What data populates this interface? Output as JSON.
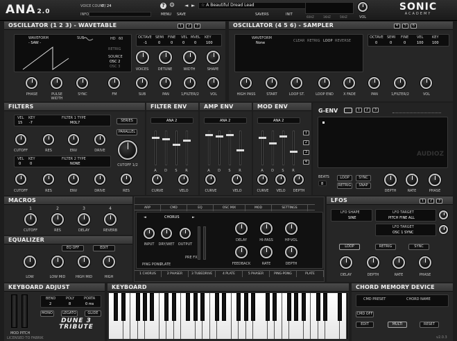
{
  "top": {
    "logo": "ANA",
    "logo_ver": "2.0",
    "voice_count_label": "VOICE COUNT",
    "voice_count": "0 / 24",
    "info_label": "INFO",
    "menu": "MENU",
    "save": "SAVE",
    "preset_name": "A Beautiful Dread Lead",
    "savers": "SAVERS",
    "init": "INIT",
    "scope_labels": [
      "60HZ",
      "1KHZ",
      "5KHZ"
    ],
    "vol": "VOL",
    "brand": "SONIC",
    "brand_sub": "ACADEMY"
  },
  "osc1": {
    "title": "OSCILLATOR (1 2 3) - WAVETABLE",
    "tabs": [
      "1",
      "2",
      "3"
    ],
    "waveform_label": "WAVEFORM",
    "waveform": "- SAW -",
    "sub_label": "SUB",
    "hd": "HD",
    "hd_val": "60",
    "retrig": "RETRIG",
    "source": "SOURCE",
    "osc2": "OSC 2",
    "osc3": "OSC 3",
    "param_heads": [
      "OCTAVE",
      "SEMI",
      "FINE",
      "VEL",
      "MVEL",
      "KEY"
    ],
    "param_vals": [
      "-1",
      "0",
      "0",
      "0",
      "0",
      "100"
    ],
    "knobs_row1": [
      "VOICES",
      "DETUNE",
      "WIDTH",
      "SHAPE"
    ],
    "knobs_row2": [
      "PHASE",
      "PULSE WIDTH",
      "SYNC",
      "FM",
      "SUB",
      "PAN",
      "1/FILTER/2",
      "VOL"
    ]
  },
  "osc2": {
    "title": "OSCILLATOR (4 5 6) - SAMPLER",
    "tabs": [
      "4",
      "5",
      "6"
    ],
    "waveform_label": "WAVEFORM",
    "waveform": "None",
    "opts": [
      "CLEAR",
      "RETRIG",
      "LOOP",
      "REVERSE"
    ],
    "param_heads": [
      "OCTAVE",
      "SEMI",
      "FINE",
      "VEL",
      "KEY"
    ],
    "param_vals": [
      "0",
      "0",
      "0",
      "100",
      "100"
    ],
    "knobs": [
      "HIGH PASS",
      "START",
      "LOOP ST.",
      "LOOP END",
      "X FADE",
      "PAN",
      "1/FILTER/2",
      "VOL"
    ]
  },
  "filters": {
    "title": "FILTERS",
    "vel_label": "VEL",
    "key_label": "KEY",
    "f1_vel": "15",
    "f1_key": "-7",
    "f1_type_label": "FILTER 1 TYPE",
    "f1_type": "MOL7",
    "series": "SERIES",
    "parallel": "PARALLEL",
    "f2_vel": "0",
    "f2_key": "0",
    "f2_type_label": "FILTER 2 TYPE",
    "f2_type": "NONE",
    "row1": [
      "CUTOFF",
      "RES",
      "ENV",
      "DRIVE"
    ],
    "row2": [
      "CUTOFF",
      "RES",
      "ENV",
      "DRIVE",
      "RES"
    ],
    "cutoff12": "CUTOFF 1/2"
  },
  "filter_env": {
    "title": "FILTER ENV",
    "select": "ANA 2",
    "adsr": [
      "A",
      "D",
      "S",
      "R"
    ],
    "knobs": [
      "CURVE",
      "VELO"
    ]
  },
  "amp_env": {
    "title": "AMP ENV",
    "select": "ANA 2",
    "adsr": [
      "A",
      "D",
      "S",
      "R"
    ],
    "knobs": [
      "CURVE",
      "VELO"
    ]
  },
  "mod_env": {
    "title": "MOD ENV",
    "select": "ANA 2",
    "adsr": [
      "A",
      "D",
      "S",
      "R"
    ],
    "knobs": [
      "CURVE",
      "VELO",
      "DEPTH"
    ],
    "side": [
      "1",
      "2",
      "3",
      "4"
    ]
  },
  "genv": {
    "title": "G-ENV",
    "tabs": [
      "1",
      "2",
      "3"
    ],
    "beats_label": "BEATS",
    "beats": "8",
    "loop": "LOOP",
    "sync": "SYNC",
    "retrig": "RETRIG",
    "snap": "SNAP",
    "knobs": [
      "DEPTH",
      "RATE",
      "PHASE"
    ],
    "watermark": "AUDIOZ"
  },
  "macros": {
    "title": "MACROS",
    "nums": [
      "1",
      "2",
      "3",
      "4"
    ],
    "labels": [
      "CUTOFF",
      "RES",
      "DELAY",
      "REVERB"
    ]
  },
  "fx": {
    "tabs": [
      "ARP",
      "CMD",
      "EQ",
      "OSC MIX",
      "MOD",
      "SETTINGS"
    ],
    "select": "CHORUS",
    "left_knobs": [
      "INPUT",
      "DRY/WET",
      "OUTPUT"
    ],
    "ping_pong": "PING PONG",
    "plate": "PLATE",
    "pre_fx": "PRE FX",
    "right_knobs_top": [
      "DELAY",
      "HI-PASS",
      "HP-VOL"
    ],
    "right_knobs_bot": [
      "FEEDBACK",
      "RATE",
      "DEPTH"
    ],
    "chain": [
      "1 CHORUS",
      "2 PHASER",
      "3 TUBEDRIVE",
      "4 PLATE",
      "5 PHASER",
      "PING-PONG",
      "PLATE"
    ]
  },
  "equalizer": {
    "title": "EQUALIZER",
    "eq_off": "EQ OFF",
    "edit": "EDIT",
    "knobs": [
      "LOW",
      "LOW MID",
      "HIGH MID",
      "HIGH"
    ]
  },
  "lfos": {
    "title": "LFOS",
    "tabs": [
      "1",
      "2",
      "3"
    ],
    "shape_label": "LFO SHAPE",
    "shape": "SINE",
    "t1_label": "LFO TARGET",
    "t1": "PITCH FINE ALL",
    "t2_label": "LFO TARGET",
    "t2": "OSC 1 SYNC",
    "loop": "LOOP",
    "retrig": "RETRIG",
    "sync": "SYNC",
    "knobs": [
      "DELAY",
      "DEPTH",
      "RATE",
      "PHASE"
    ]
  },
  "kbd_adjust": {
    "title": "KEYBOARD ADJUST",
    "heads": [
      "BEND",
      "POLY",
      "PORTA"
    ],
    "vals": [
      "2",
      "8",
      "0 ms"
    ],
    "mono": "MONO",
    "legato": "LEGATO",
    "glide": "GLIDE",
    "mod": "MOD",
    "pitch": "PITCH",
    "dune": "DUNE 3",
    "tribute": "TRIBUTE",
    "licensed": "LICENSED TO FABRIK"
  },
  "keyboard": {
    "title": "KEYBOARD"
  },
  "chord": {
    "title": "CHORD MEMORY DEVICE",
    "cmd_preset": "CMD PRESET",
    "chord_name": "CHORD NAME",
    "cmd_off": "CMD OFF",
    "edit": "EDIT",
    "multi": "MULTI",
    "reset": "RESET",
    "version": "v2.0.3"
  }
}
